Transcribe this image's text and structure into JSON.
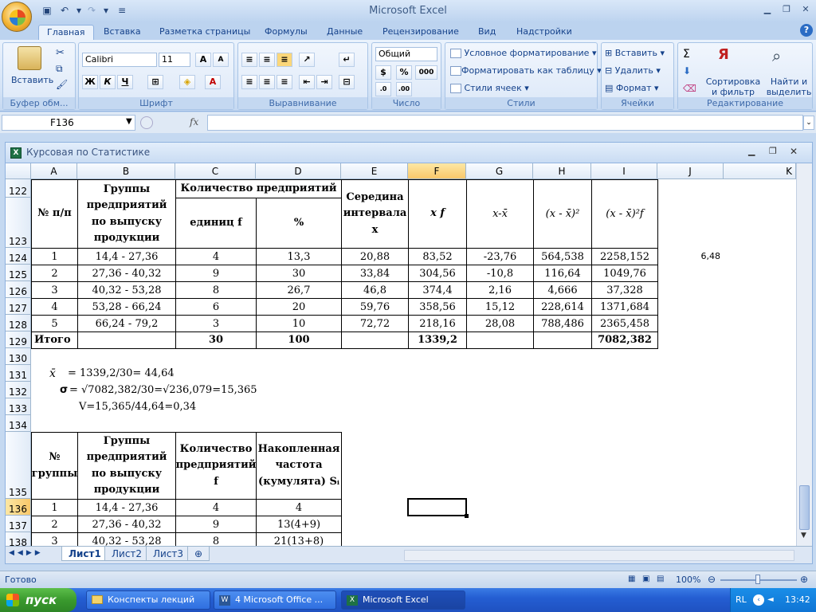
{
  "window": {
    "title": "Microsoft Excel"
  },
  "quick_access": [
    "save-icon",
    "undo-icon",
    "redo-icon"
  ],
  "tabs": [
    "Главная",
    "Вставка",
    "Разметка страницы",
    "Формулы",
    "Данные",
    "Рецензирование",
    "Вид",
    "Надстройки"
  ],
  "ribbon": {
    "clipboard": {
      "label": "Буфер обм...",
      "paste": "Вставить"
    },
    "font": {
      "label": "Шрифт",
      "name": "Calibri",
      "size": "11",
      "bold": "Ж",
      "italic": "К",
      "underline": "Ч"
    },
    "alignment": {
      "label": "Выравнивание"
    },
    "number": {
      "label": "Число",
      "format": "Общий",
      "percent": "%",
      "thousands": "000"
    },
    "styles": {
      "label": "Стили",
      "cond": "Условное форматирование",
      "table": "Форматировать как таблицу",
      "cell": "Стили ячеек"
    },
    "cells": {
      "label": "Ячейки",
      "insert": "Вставить",
      "delete": "Удалить",
      "format": "Формат"
    },
    "editing": {
      "label": "Редактирование",
      "sort": "Сортировка и фильтр",
      "find": "Найти и выделить"
    }
  },
  "formula_bar": {
    "name_box": "F136",
    "fx": "fx",
    "formula": ""
  },
  "workbook": {
    "title": "Курсовая по Статистике"
  },
  "columns": [
    "A",
    "B",
    "C",
    "D",
    "E",
    "F",
    "G",
    "H",
    "I",
    "J",
    "K"
  ],
  "rows": [
    "122",
    "123",
    "124",
    "125",
    "126",
    "127",
    "128",
    "129",
    "130",
    "131",
    "132",
    "133",
    "134",
    "135",
    "136",
    "137",
    "138"
  ],
  "table1": {
    "headers": {
      "num": "№ п/п",
      "groups": "Группы предприятий по выпуску продукции",
      "count": "Количество предприятий",
      "units": "единиц f",
      "pct": "%",
      "mid": "Середина интервала x",
      "xf": "x f",
      "dev": "x-x̄",
      "dev2": "(x - x̄)²",
      "dev2f": "(x - x̄)²f"
    },
    "rows": [
      [
        "1",
        "14,4 - 27,36",
        "4",
        "13,3",
        "20,88",
        "83,52",
        "-23,76",
        "564,538",
        "2258,152"
      ],
      [
        "2",
        "27,36 - 40,32",
        "9",
        "30",
        "33,84",
        "304,56",
        "-10,8",
        "116,64",
        "1049,76"
      ],
      [
        "3",
        "40,32 - 53,28",
        "8",
        "26,7",
        "46,8",
        "374,4",
        "2,16",
        "4,666",
        "37,328"
      ],
      [
        "4",
        "53,28 - 66,24",
        "6",
        "20",
        "59,76",
        "358,56",
        "15,12",
        "228,614",
        "1371,684"
      ],
      [
        "5",
        "66,24 - 79,2",
        "3",
        "10",
        "72,72",
        "218,16",
        "28,08",
        "788,486",
        "2365,458"
      ]
    ],
    "total": {
      "label": "Итого",
      "count": "30",
      "pct": "100",
      "xf": "1339,2",
      "dev2f": "7082,382"
    },
    "extra_j124": "6,48"
  },
  "calcs": {
    "mean_sym": "x̄",
    "mean": "= 1339,2/30= 44,64",
    "sigma_sym": "σ",
    "sigma": "= √7082,382/30=√236,079=15,365",
    "v": "V=15,365/44,64=0,34"
  },
  "table2": {
    "headers": {
      "num": "№ группы",
      "groups": "Группы предприятий по выпуску продукции",
      "count": "Количество предприятий f",
      "cum": "Накопленная частота (кумулята) Sᵢ"
    },
    "rows": [
      [
        "1",
        "14,4 - 27,36",
        "4",
        "4"
      ],
      [
        "2",
        "27,36 - 40,32",
        "9",
        "13(4+9)"
      ],
      [
        "3",
        "40,32 - 53,28",
        "8",
        "21(13+8)"
      ]
    ]
  },
  "sheets": [
    "Лист1",
    "Лист2",
    "Лист3"
  ],
  "status": {
    "ready": "Готово",
    "zoom": "100%"
  },
  "taskbar": {
    "start": "пуск",
    "items": [
      "Конспекты лекций",
      "4 Microsoft Office ...",
      "Microsoft Excel"
    ],
    "lang": "RL",
    "time": "13:42"
  }
}
